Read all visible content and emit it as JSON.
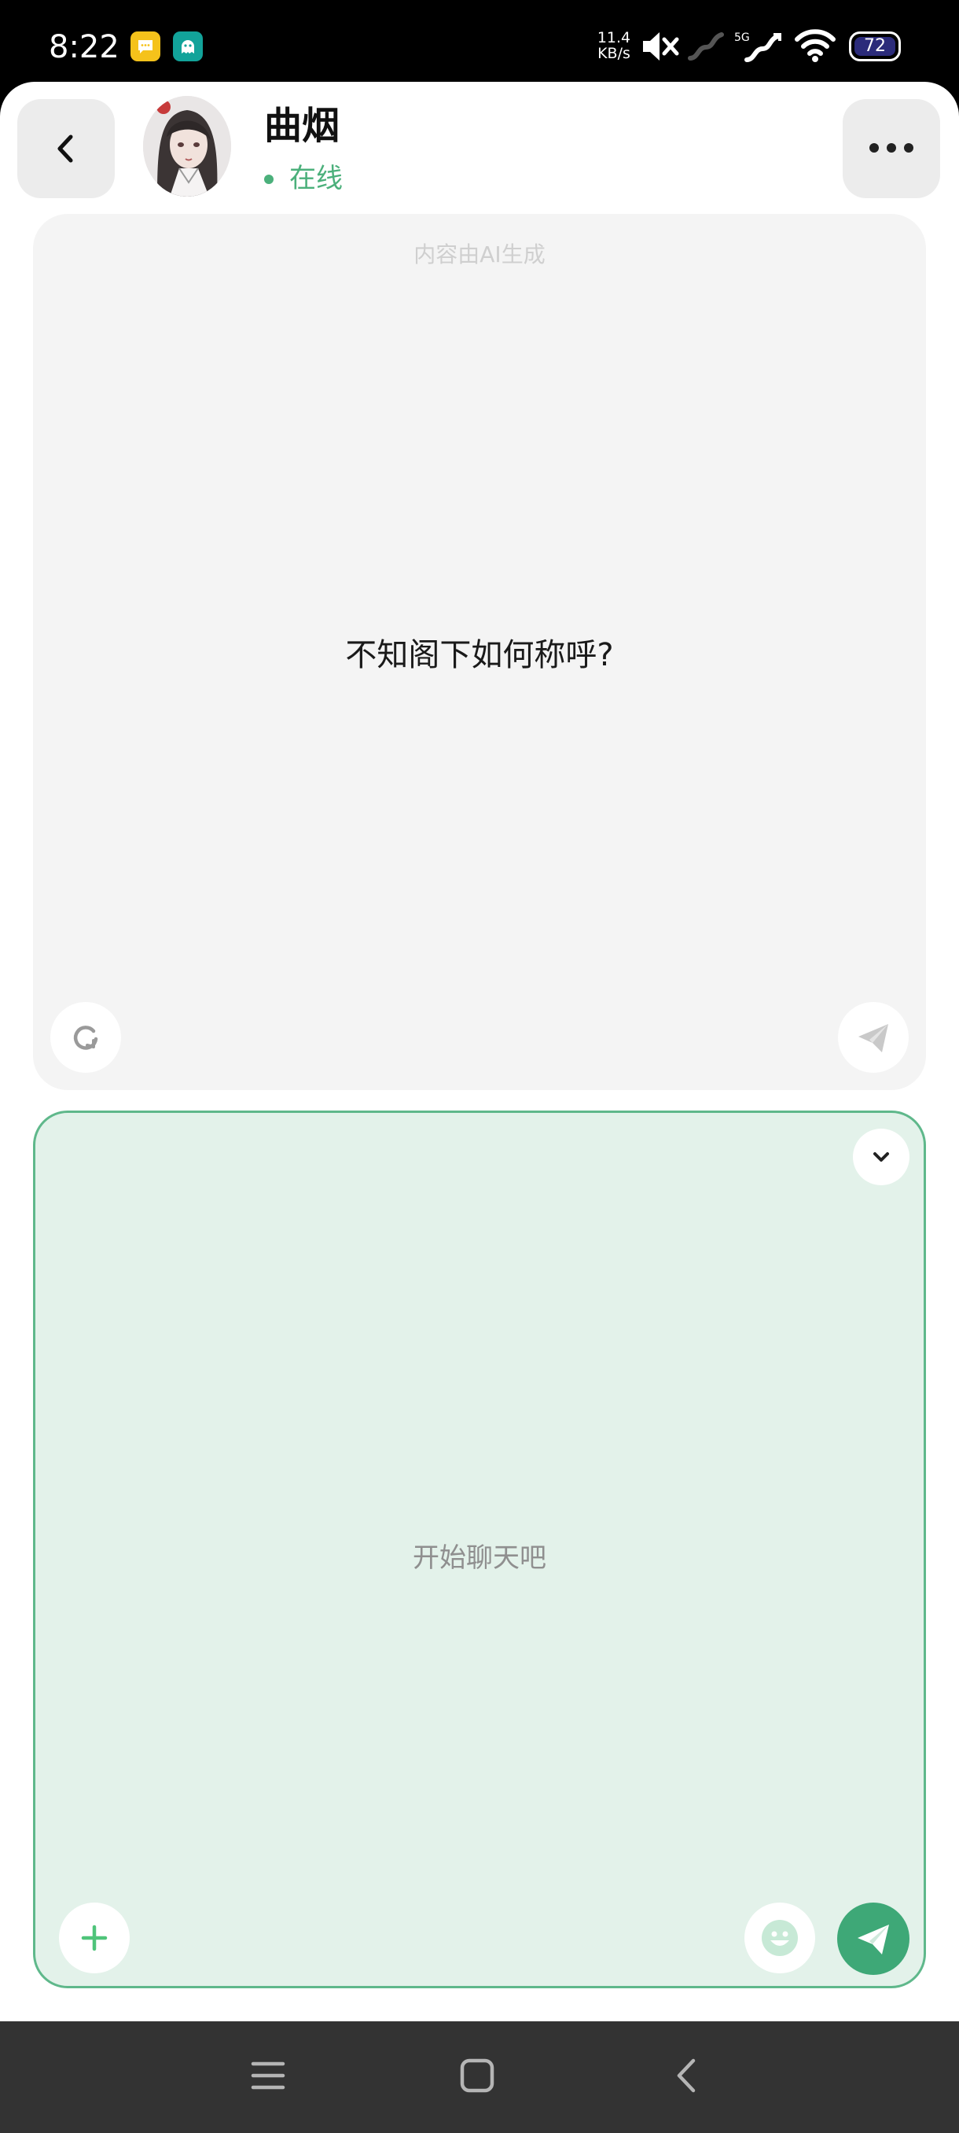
{
  "status_bar": {
    "time": "8:22",
    "net_speed_value": "11.4",
    "net_speed_unit": "KB/s",
    "network_type": "5G",
    "battery_level": "72",
    "icons": [
      "chat-notification-icon",
      "ghost-app-icon",
      "mute-icon",
      "signal-icon",
      "wifi-icon",
      "battery-icon"
    ]
  },
  "header": {
    "name": "曲烟",
    "status": "在线",
    "status_color": "#4bb07b"
  },
  "ai_card": {
    "disclaimer": "内容由AI生成",
    "message": "不知阁下如何称呼?"
  },
  "input_card": {
    "placeholder": "开始聊天吧",
    "accent_color": "#3ea877",
    "background_color": "#e3f2ea"
  },
  "nav_bar": {
    "icons": [
      "menu-icon",
      "home-icon",
      "back-icon"
    ]
  }
}
